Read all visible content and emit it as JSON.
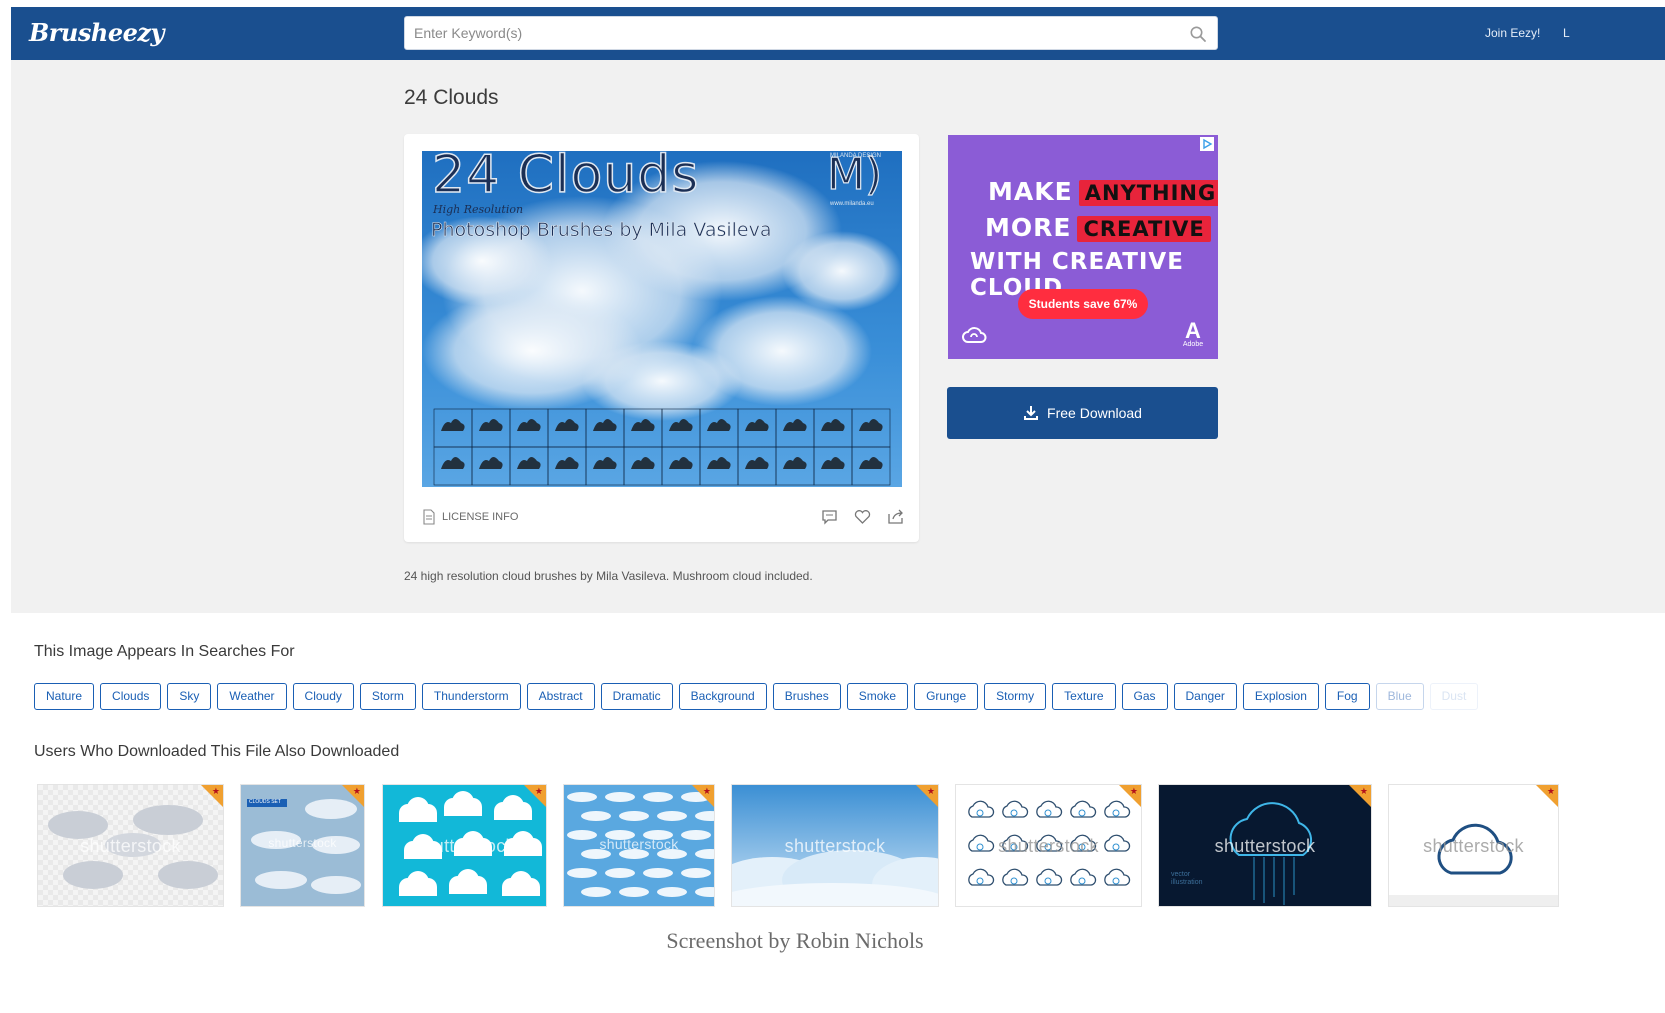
{
  "header": {
    "logo": "Brusheezy",
    "search_placeholder": "Enter Keyword(s)",
    "join_label": "Join Eezy!",
    "more_label": "L"
  },
  "main": {
    "title": "24 Clouds",
    "preview": {
      "heading": "24 Clouds",
      "brand": "M)",
      "subtitle_script": "High Resolution",
      "subtitle": "Photoshop Brushes by Mila Vasileva",
      "credit_top": "MILANDA DESIGN",
      "credit_url": "www.milanda.eu"
    },
    "license_label": "LICENSE INFO",
    "description": "24 high resolution cloud brushes by Mila Vasileva. Mushroom cloud included.",
    "download_label": "Free Download"
  },
  "ad": {
    "line1_a": "MAKE",
    "line1_b": "ANYTHING",
    "line2_a": "MORE",
    "line2_b": "CREATIVE",
    "line3": "WITH CREATIVE CLOUD",
    "cta": "Students save 67%",
    "brand": "Adobe",
    "colors": {
      "bg": "#8b5cd6",
      "highlight": "#e8243b"
    }
  },
  "searches": {
    "heading": "This Image Appears In Searches For",
    "tags": [
      "Nature",
      "Clouds",
      "Sky",
      "Weather",
      "Cloudy",
      "Storm",
      "Thunderstorm",
      "Abstract",
      "Dramatic",
      "Background",
      "Brushes",
      "Smoke",
      "Grunge",
      "Stormy",
      "Texture",
      "Gas",
      "Danger",
      "Explosion",
      "Fog",
      "Blue",
      "Dust"
    ]
  },
  "related": {
    "heading": "Users Who Downloaded This File Also Downloaded",
    "watermark": "shutterstock",
    "items": [
      {
        "name": "transparent-clouds"
      },
      {
        "name": "clouds-set",
        "label": "CLOUDS SET"
      },
      {
        "name": "cartoon-clouds-cyan"
      },
      {
        "name": "flat-clouds-blue"
      },
      {
        "name": "sky-gradient-clouds"
      },
      {
        "name": "cloud-icons-grid"
      },
      {
        "name": "digital-cloud",
        "label": "vector illustration"
      },
      {
        "name": "cloud-outline-icon"
      }
    ]
  },
  "footer": {
    "credit": "Screenshot  by Robin Nichols"
  },
  "colors": {
    "brand": "#1a4f8f",
    "tag": "#1a5fb4",
    "band": "#f1f1f1"
  }
}
